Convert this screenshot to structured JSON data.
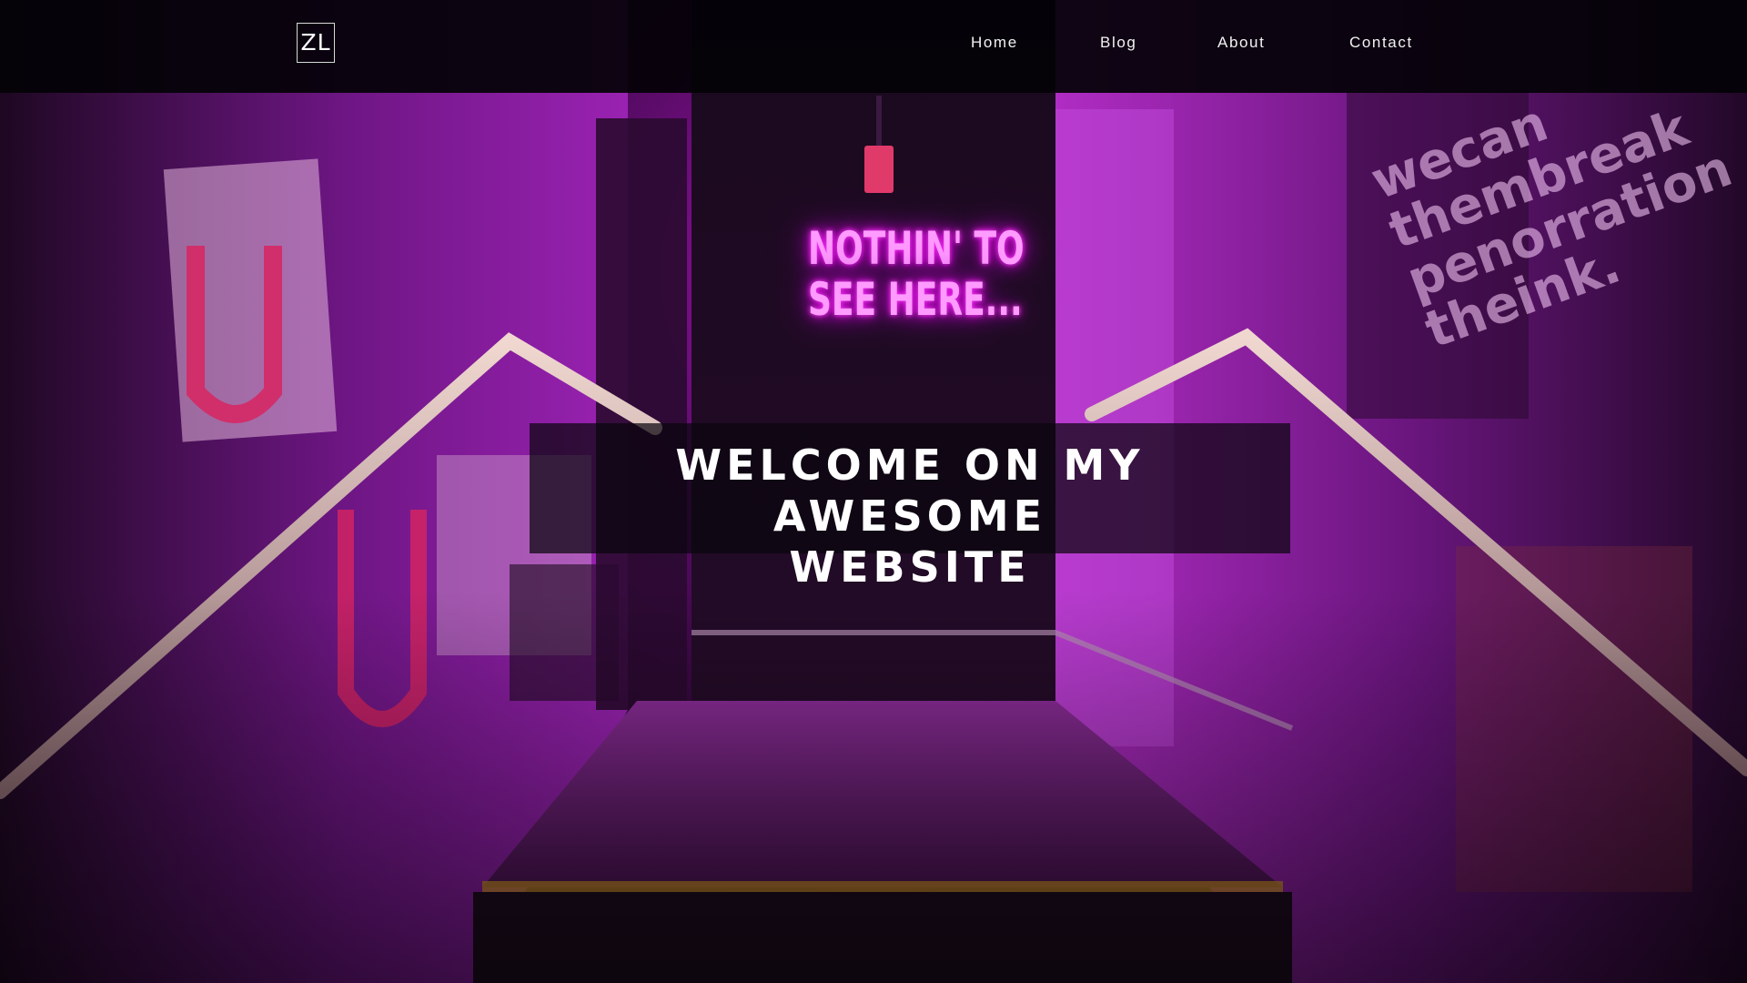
{
  "header": {
    "logo": "ZL",
    "nav": [
      {
        "label": "Home"
      },
      {
        "label": "Blog"
      },
      {
        "label": "About"
      },
      {
        "label": "Contact"
      }
    ]
  },
  "hero": {
    "title_lines": [
      "WELCOME ON MY AWESOME",
      "WEBSITE"
    ],
    "neon_sign_lines": [
      "NOTHIN' TO",
      "SEE HERE..."
    ],
    "wall_poster_lines": [
      "wecan",
      "thembreak",
      "penorration",
      "theink."
    ]
  },
  "colors": {
    "accent": "#e020e0",
    "nav_background": "#030206",
    "text": "#ffffff"
  }
}
